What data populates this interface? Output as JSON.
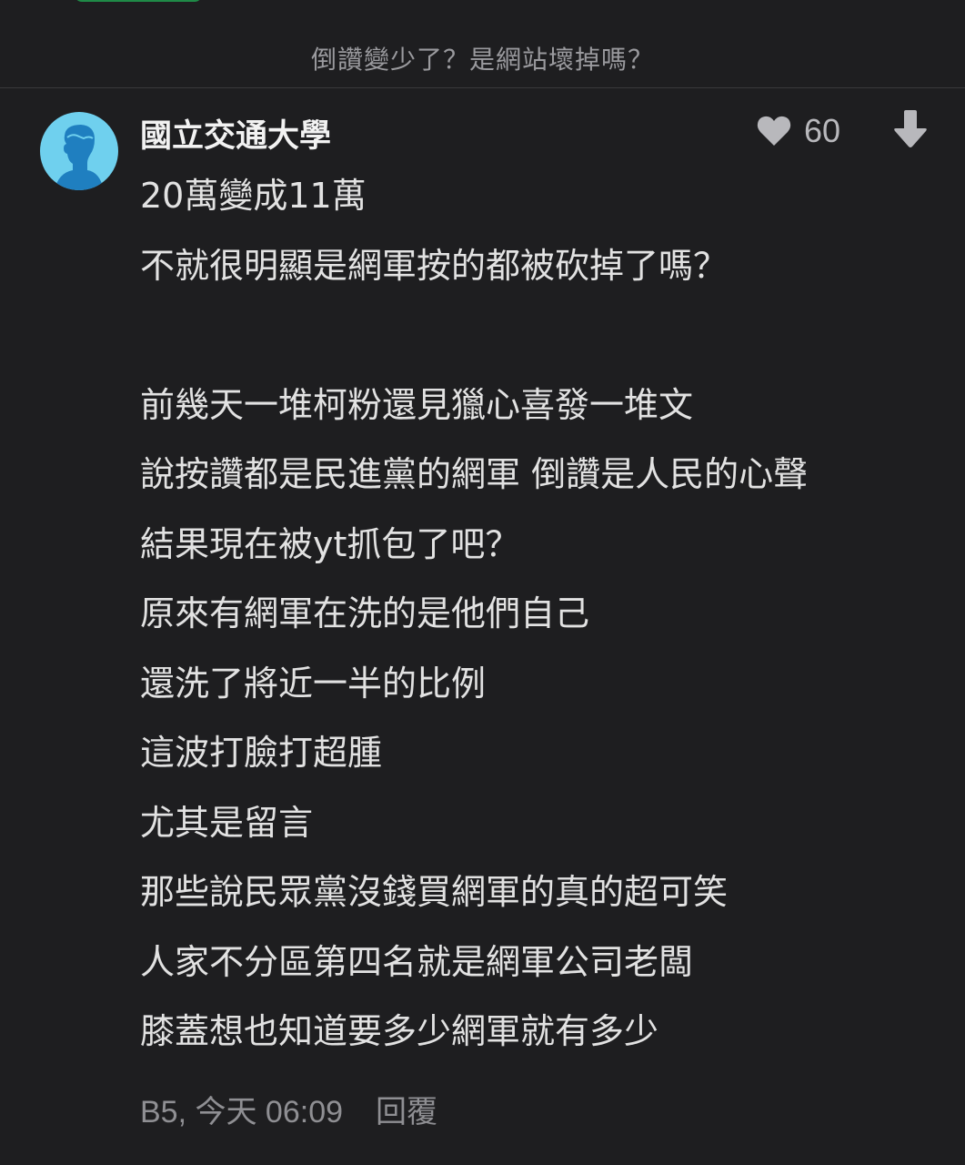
{
  "header": {
    "title": "倒讚變少了？是網站壞掉嗎？"
  },
  "comment": {
    "author": "國立交通大學",
    "likes": "60",
    "lines": [
      "20萬變成11萬",
      "不就很明顯是網軍按的都被砍掉了嗎？",
      "",
      "前幾天一堆柯粉還見獵心喜發一堆文",
      "說按讚都是民進黨的網軍 倒讚是人民的心聲",
      "結果現在被yt抓包了吧？",
      "原來有網軍在洗的是他們自己",
      "還洗了將近一半的比例",
      "這波打臉打超腫",
      "尤其是留言",
      "那些說民眾黨沒錢買網軍的真的超可笑",
      "人家不分區第四名就是網軍公司老闆",
      "膝蓋想也知道要多少網軍就有多少"
    ],
    "meta": "B5, 今天 06:09",
    "reply_label": "回覆"
  },
  "colors": {
    "background": "#1e1e20",
    "avatar": "#6fd0ee",
    "avatar_figure": "#1f7fc0",
    "accent_green": "#1f8a47"
  },
  "icons": {
    "like": "heart-icon",
    "dislike": "arrow-down-icon",
    "avatar": "user-silhouette-icon"
  }
}
